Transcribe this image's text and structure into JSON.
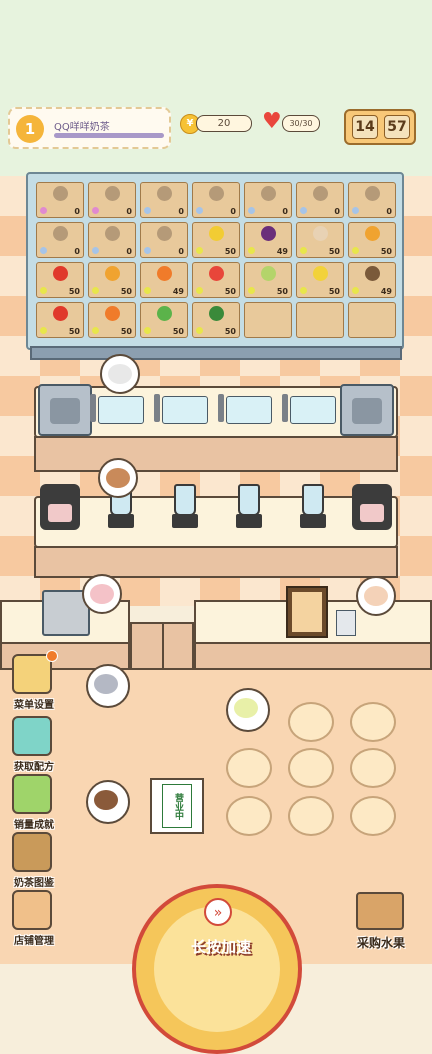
{
  "header": {
    "level": "1",
    "store_name": "QQ咩咩奶茶",
    "coins": "20",
    "hearts": "30/30",
    "coin_symbol": "¥",
    "timer_hour": "14",
    "timer_min": "57"
  },
  "shelf": {
    "slots": [
      {
        "count": "0",
        "fruit": "#b59a78",
        "dot": "#e08ad0"
      },
      {
        "count": "0",
        "fruit": "#b59a78",
        "dot": "#e08ad0"
      },
      {
        "count": "0",
        "fruit": "#b59a78",
        "dot": "#a6c4e8"
      },
      {
        "count": "0",
        "fruit": "#b59a78",
        "dot": "#a6c4e8"
      },
      {
        "count": "0",
        "fruit": "#b59a78",
        "dot": "#a6c4e8"
      },
      {
        "count": "0",
        "fruit": "#b59a78",
        "dot": "#a6c4e8"
      },
      {
        "count": "0",
        "fruit": "#b59a78",
        "dot": "#a6c4e8"
      },
      {
        "count": "0",
        "fruit": "#b59a78",
        "dot": "#a6c4e8"
      },
      {
        "count": "0",
        "fruit": "#b59a78",
        "dot": "#a6c4e8"
      },
      {
        "count": "0",
        "fruit": "#b59a78",
        "dot": "#a6c4e8"
      },
      {
        "count": "50",
        "fruit": "#f2cc33",
        "dot": "#e8e64a"
      },
      {
        "count": "49",
        "fruit": "#6a2e7a",
        "dot": "#e8e64a"
      },
      {
        "count": "50",
        "fruit": "#e8d2b4",
        "dot": "#e8e64a"
      },
      {
        "count": "50",
        "fruit": "#f0a330",
        "dot": "#e8e64a"
      },
      {
        "count": "50",
        "fruit": "#e0392b",
        "dot": "#e8e64a"
      },
      {
        "count": "50",
        "fruit": "#f0a330",
        "dot": "#e8e64a"
      },
      {
        "count": "49",
        "fruit": "#f07b2a",
        "dot": "#e8e64a"
      },
      {
        "count": "50",
        "fruit": "#e8463a",
        "dot": "#e8e64a"
      },
      {
        "count": "50",
        "fruit": "#b4d46a",
        "dot": "#e8e64a"
      },
      {
        "count": "50",
        "fruit": "#f2d23a",
        "dot": "#e8e64a"
      },
      {
        "count": "49",
        "fruit": "#7a5a3a",
        "dot": "#e8e64a"
      },
      {
        "count": "50",
        "fruit": "#e0392b",
        "dot": "#e8e64a"
      },
      {
        "count": "50",
        "fruit": "#f07b2a",
        "dot": "#e8e64a"
      },
      {
        "count": "50",
        "fruit": "#5bb34a",
        "dot": "#e8e64a"
      },
      {
        "count": "50",
        "fruit": "#3a8a3a",
        "dot": "#e8e64a"
      },
      {
        "count": "",
        "fruit": "",
        "dot": ""
      },
      {
        "count": "",
        "fruit": "",
        "dot": ""
      },
      {
        "count": "",
        "fruit": "",
        "dot": ""
      }
    ]
  },
  "side_menu": [
    {
      "label": "菜单设置",
      "icon": "menu-book-icon",
      "color": "#f4d27a"
    },
    {
      "label": "获取配方",
      "icon": "recipe-machine-icon",
      "color": "#7fd4c8"
    },
    {
      "label": "销量成就",
      "icon": "star-trophy-icon",
      "color": "#9fd46a"
    },
    {
      "label": "奶茶图鉴",
      "icon": "milk-tea-book-icon",
      "color": "#c99a5a"
    },
    {
      "label": "店铺管理",
      "icon": "shop-icon",
      "color": "#f0c08a"
    }
  ],
  "open_sign": "营业中",
  "speed_button": "长按加速",
  "buy_fruit": "采购水果",
  "colors": {
    "accent": "#f5b53a",
    "danger": "#d24a3a"
  }
}
